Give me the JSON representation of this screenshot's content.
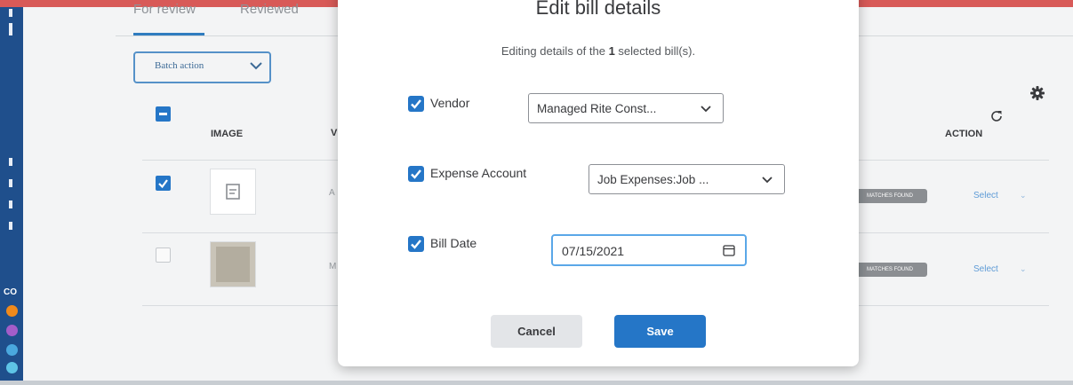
{
  "tabs": [
    "For review",
    "Reviewed"
  ],
  "batch_action": {
    "label": "Batch action"
  },
  "table": {
    "headers": [
      "IMAGE",
      "V",
      "ACTION"
    ],
    "rows": [
      {
        "vendor_cut": "A",
        "badge": "MATCHES FOUND",
        "action": "Select",
        "checked": true
      },
      {
        "vendor_cut": "M",
        "badge": "MATCHES FOUND",
        "action": "Select",
        "checked": false
      }
    ]
  },
  "left_nav": {
    "partial_label": "CO"
  },
  "modal": {
    "title": "Edit bill details",
    "subtitle_before": "Editing details of the ",
    "subtitle_count": "1",
    "subtitle_after": " selected bill(s).",
    "fields": [
      {
        "label": "Vendor",
        "value": "Managed Rite Const...",
        "checked": true
      },
      {
        "label": "Expense Account",
        "value": "Job Expenses:Job ...",
        "checked": true
      },
      {
        "label": "Bill Date",
        "value": "07/15/2021",
        "checked": true
      }
    ],
    "cancel_label": "Cancel",
    "save_label": "Save"
  },
  "colors": {
    "accent": "#2576c7",
    "top_bar": "#d85a58",
    "nav": "#1f4f8c",
    "badge": "#8b8e92"
  },
  "icons": [
    "refresh-icon",
    "gear-icon",
    "chevron-down-icon",
    "calendar-icon",
    "checkbox-icon",
    "document-icon"
  ]
}
